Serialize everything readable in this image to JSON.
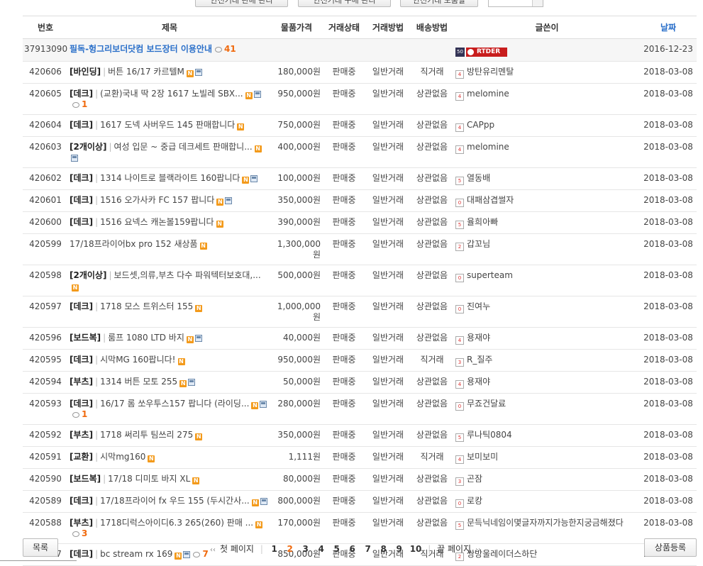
{
  "top_buttons": [
    "안전거래 판매 관리",
    "안전거래 구매 관리",
    "안전거래 도움말"
  ],
  "top_select_value": "",
  "columns": {
    "no": "번호",
    "title": "제목",
    "price": "물품가격",
    "status": "거래상태",
    "method": "거래방법",
    "ship": "배송방법",
    "author": "글쓴이",
    "date": "날짜"
  },
  "notice": {
    "no": "37913090",
    "title": "필독-헝그리보더닷컴 보드장터 이용안내",
    "comments": "41",
    "author_level": "50",
    "author_badge": "RTDER",
    "date": "2016-12-23"
  },
  "rows": [
    {
      "no": "420606",
      "cat": "[바인딩]",
      "title": "버튼 16/17 카르텔M",
      "new": true,
      "file": true,
      "comments": "",
      "price": "180,000원",
      "status": "판매중",
      "method": "일반거래",
      "ship": "직거래",
      "level": "4",
      "author": "방탄유리멘탈",
      "date": "2018-03-08"
    },
    {
      "no": "420605",
      "cat": "[데크]",
      "title": "(교환)국내 딱 2장 1617 노빌레 SBX...",
      "new": true,
      "file": true,
      "comments": "1",
      "price": "950,000원",
      "status": "판매중",
      "method": "일반거래",
      "ship": "상관없음",
      "level": "4",
      "author": "melomine",
      "date": "2018-03-08"
    },
    {
      "no": "420604",
      "cat": "[데크]",
      "title": "1617 도넥 사버우드 145 판매합니다",
      "new": true,
      "file": false,
      "comments": "",
      "price": "750,000원",
      "status": "판매중",
      "method": "일반거래",
      "ship": "상관없음",
      "level": "4",
      "author": "CAPpp",
      "date": "2018-03-08"
    },
    {
      "no": "420603",
      "cat": "[2개이상]",
      "title": "여성 입문 ~ 중급 데크세트 판매합니...",
      "new": true,
      "file": true,
      "comments": "",
      "price": "400,000원",
      "status": "판매중",
      "method": "일반거래",
      "ship": "상관없음",
      "level": "4",
      "author": "melomine",
      "date": "2018-03-08"
    },
    {
      "no": "420602",
      "cat": "[데크]",
      "title": "1314 나이트로 블랙라이트 160팝니다",
      "new": true,
      "file": true,
      "comments": "",
      "price": "100,000원",
      "status": "판매중",
      "method": "일반거래",
      "ship": "상관없음",
      "level": "5",
      "author": "열동배",
      "date": "2018-03-08"
    },
    {
      "no": "420601",
      "cat": "[데크]",
      "title": "1516 오가사카 FC 157 팝니다",
      "new": true,
      "file": true,
      "comments": "",
      "price": "350,000원",
      "status": "판매중",
      "method": "일반거래",
      "ship": "상관없음",
      "level": "0",
      "author": "대패삼겹썰자",
      "date": "2018-03-08"
    },
    {
      "no": "420600",
      "cat": "[데크]",
      "title": "1516 요넥스 캐논볼159팝니다",
      "new": true,
      "file": false,
      "comments": "",
      "price": "390,000원",
      "status": "판매중",
      "method": "일반거래",
      "ship": "상관없음",
      "level": "5",
      "author": "율희아빠",
      "date": "2018-03-08"
    },
    {
      "no": "420599",
      "cat": "",
      "title": "17/18프라이어bx pro 152 새상품",
      "new": true,
      "file": false,
      "comments": "",
      "price": "1,300,000원",
      "status": "판매중",
      "method": "일반거래",
      "ship": "상관없음",
      "level": "2",
      "author": "갑꼬님",
      "date": "2018-03-08"
    },
    {
      "no": "420598",
      "cat": "[2개이상]",
      "title": "보드셋,의류,부츠 다수 파워텍터보호대,...",
      "new": true,
      "file": false,
      "comments": "",
      "price": "500,000원",
      "status": "판매중",
      "method": "일반거래",
      "ship": "상관없음",
      "level": "0",
      "author": "superteam",
      "date": "2018-03-08"
    },
    {
      "no": "420597",
      "cat": "[데크]",
      "title": "1718 모스 트위스터 155",
      "new": true,
      "file": false,
      "comments": "",
      "price": "1,000,000원",
      "status": "판매중",
      "method": "일반거래",
      "ship": "상관없음",
      "level": "0",
      "author": "진여누",
      "date": "2018-03-08"
    },
    {
      "no": "420596",
      "cat": "[보드복]",
      "title": "룸프 1080 LTD 바지",
      "new": true,
      "file": true,
      "comments": "",
      "price": "40,000원",
      "status": "판매중",
      "method": "일반거래",
      "ship": "상관없음",
      "level": "4",
      "author": "용재야",
      "date": "2018-03-08"
    },
    {
      "no": "420595",
      "cat": "[데크]",
      "title": "시막MG 160팝니다!",
      "new": true,
      "file": false,
      "comments": "",
      "price": "950,000원",
      "status": "판매중",
      "method": "일반거래",
      "ship": "직거래",
      "level": "3",
      "author": "R_질주",
      "date": "2018-03-08"
    },
    {
      "no": "420594",
      "cat": "[부츠]",
      "title": "1314 버튼 모토 255",
      "new": true,
      "file": true,
      "comments": "",
      "price": "50,000원",
      "status": "판매중",
      "method": "일반거래",
      "ship": "상관없음",
      "level": "4",
      "author": "용재야",
      "date": "2018-03-08"
    },
    {
      "no": "420593",
      "cat": "[데크]",
      "title": "16/17 롬 쏘우투스157 팝니다 (라이딩...",
      "new": true,
      "file": true,
      "comments": "1",
      "price": "280,000원",
      "status": "판매중",
      "method": "일반거래",
      "ship": "상관없음",
      "level": "0",
      "author": "무죠건달료",
      "date": "2018-03-08"
    },
    {
      "no": "420592",
      "cat": "[부츠]",
      "title": "1718 써리투 팀쓰리 275",
      "new": true,
      "file": false,
      "comments": "",
      "price": "350,000원",
      "status": "판매중",
      "method": "일반거래",
      "ship": "상관없음",
      "level": "5",
      "author": "루나틱0804",
      "date": "2018-03-08"
    },
    {
      "no": "420591",
      "cat": "[교환]",
      "title": "시막mg160",
      "new": true,
      "file": false,
      "comments": "",
      "price": "1,111원",
      "status": "판매중",
      "method": "일반거래",
      "ship": "직거래",
      "level": "4",
      "author": "보미보미",
      "date": "2018-03-08"
    },
    {
      "no": "420590",
      "cat": "[보드복]",
      "title": "17/18 디미토 바지 XL",
      "new": true,
      "file": false,
      "comments": "",
      "price": "80,000원",
      "status": "판매중",
      "method": "일반거래",
      "ship": "상관없음",
      "level": "3",
      "author": "곤잠",
      "date": "2018-03-08"
    },
    {
      "no": "420589",
      "cat": "[데크]",
      "title": "17/18프라이어 fx 우드 155 (두시간사...",
      "new": true,
      "file": true,
      "comments": "",
      "price": "800,000원",
      "status": "판매중",
      "method": "일반거래",
      "ship": "상관없음",
      "level": "0",
      "author": "로캉",
      "date": "2018-03-08"
    },
    {
      "no": "420588",
      "cat": "[부츠]",
      "title": "1718디럭스아이디6.3 265(260) 판매 ...",
      "new": true,
      "file": false,
      "comments": "3",
      "price": "170,000원",
      "status": "판매중",
      "method": "일반거래",
      "ship": "상관없음",
      "level": "5",
      "author": "문득닉네임이몇글자까지가능한지궁금해졌다",
      "date": "2018-03-08"
    },
    {
      "no": "420587",
      "cat": "[데크]",
      "title": "bc stream rx 169",
      "new": true,
      "file": true,
      "comments": "7",
      "price": "850,000원",
      "status": "판매중",
      "method": "일반거래",
      "ship": "직거래",
      "level": "2",
      "author": "쌍방울레이더스하단",
      "date": "2018-03-08"
    }
  ],
  "bottom": {
    "list_button": "목록",
    "first_page": "첫 페이지",
    "last_page": "끝 페이지",
    "pages": [
      "1",
      "2",
      "3",
      "4",
      "5",
      "6",
      "7",
      "8",
      "9",
      "10"
    ],
    "current_page": "2",
    "register_button": "상품등록"
  },
  "icons": {
    "new": "N",
    "file": "file-icon",
    "comment": "comment-icon"
  },
  "colors": {
    "accent": "#f06a0e",
    "link": "#2a6fc9"
  }
}
